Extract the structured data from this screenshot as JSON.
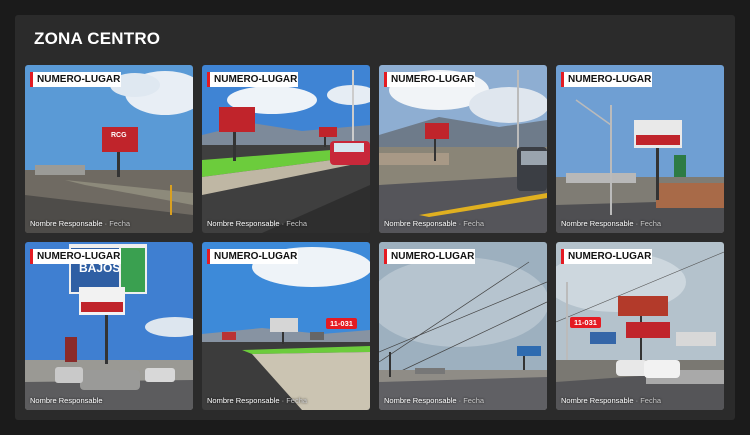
{
  "zone": {
    "title": "ZONA CENTRO"
  },
  "cards": [
    {
      "label": "NUMERO-LUGAR",
      "responsible": "Nombre Responsable",
      "date_sep": " · ",
      "date": "Fecha"
    },
    {
      "label": "NUMERO-LUGAR",
      "responsible": "Nombre Responsable",
      "date_sep": " · ",
      "date": "Fecha"
    },
    {
      "label": "NUMERO-LUGAR",
      "responsible": "Nombre Responsable",
      "date_sep": " · ",
      "date": "Fecha"
    },
    {
      "label": "NUMERO-LUGAR",
      "responsible": "Nombre Responsable",
      "date_sep": " · ",
      "date": "Fecha"
    },
    {
      "label": "NUMERO-LUGAR",
      "responsible": "Nombre Responsable",
      "date_sep": "",
      "date": ""
    },
    {
      "label": "NUMERO-LUGAR",
      "responsible": "Nombre Responsable",
      "date_sep": " · ",
      "date": "Fecha",
      "badge": "11-031"
    },
    {
      "label": "NUMERO-LUGAR",
      "responsible": "Nombre Responsable",
      "date_sep": " · ",
      "date": "Fecha"
    },
    {
      "label": "NUMERO-LUGAR",
      "responsible": "Nombre Responsable",
      "date_sep": " · ",
      "date": "Fecha",
      "badge": "11-031"
    }
  ],
  "billboard_texts": {
    "logo": "RCG",
    "sign_bajos": "BAJOS"
  },
  "colors": {
    "accent": "#e41b23",
    "panel": "#2b2b2b",
    "page": "#1b1b1b"
  }
}
